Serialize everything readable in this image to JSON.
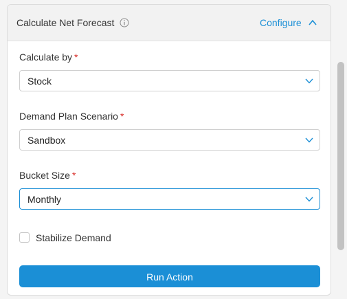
{
  "panel": {
    "title": "Calculate Net Forecast",
    "configure_label": "Configure"
  },
  "form": {
    "calculate_by": {
      "label": "Calculate by",
      "required_mark": "*",
      "value": "Stock"
    },
    "demand_plan_scenario": {
      "label": "Demand Plan Scenario",
      "required_mark": "*",
      "value": "Sandbox"
    },
    "bucket_size": {
      "label": "Bucket Size",
      "required_mark": "*",
      "value": "Monthly"
    },
    "stabilize_demand": {
      "label": "Stabilize Demand",
      "checked": false
    },
    "run_action_label": "Run Action"
  },
  "icons": {
    "info": "info-icon",
    "collapse": "chevron-up-icon",
    "dropdown": "chevron-down-icon"
  },
  "colors": {
    "accent": "#1b8fd6",
    "required": "#d9302c",
    "header_bg": "#f2f2f2"
  }
}
